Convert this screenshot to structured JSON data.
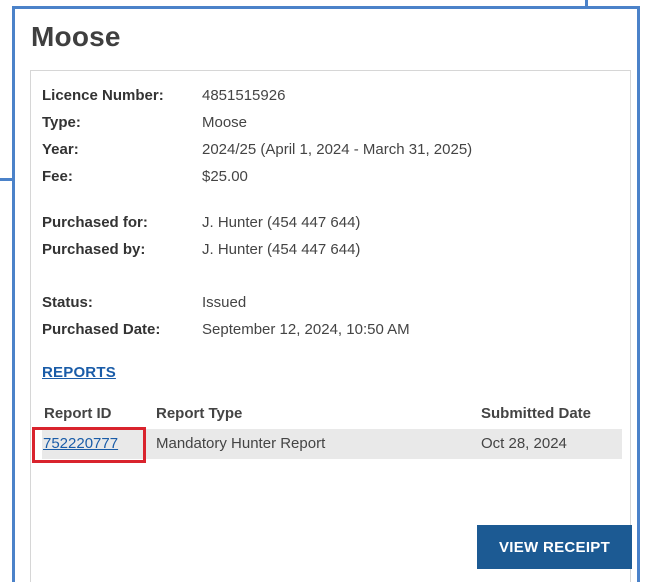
{
  "page": {
    "title": "Moose"
  },
  "licence": {
    "number_label": "Licence Number:",
    "number_value": "4851515926",
    "type_label": "Type:",
    "type_value": "Moose",
    "year_label": "Year:",
    "year_value": "2024/25 (April 1, 2024 - March 31, 2025)",
    "fee_label": "Fee:",
    "fee_value": "$25.00",
    "purchased_for_label": "Purchased for:",
    "purchased_for_value": "J. Hunter (454 447 644)",
    "purchased_by_label": "Purchased by:",
    "purchased_by_value": "J. Hunter (454 447 644)",
    "status_label": "Status:",
    "status_value": "Issued",
    "purchased_date_label": "Purchased Date:",
    "purchased_date_value": "September 12, 2024, 10:50 AM"
  },
  "reports": {
    "heading": "REPORTS",
    "columns": {
      "id": "Report ID",
      "type": "Report Type",
      "submitted": "Submitted Date"
    },
    "rows": [
      {
        "id": "752220777",
        "type": "Mandatory Hunter Report",
        "submitted": "Oct 28, 2024"
      }
    ]
  },
  "actions": {
    "view_receipt": "VIEW RECEIPT"
  },
  "colors": {
    "frame_border": "#4b82c9",
    "link": "#1a5ca8",
    "highlight_box": "#d9232d",
    "button_bg": "#1c5a93",
    "row_bg": "#e9e9e9"
  }
}
